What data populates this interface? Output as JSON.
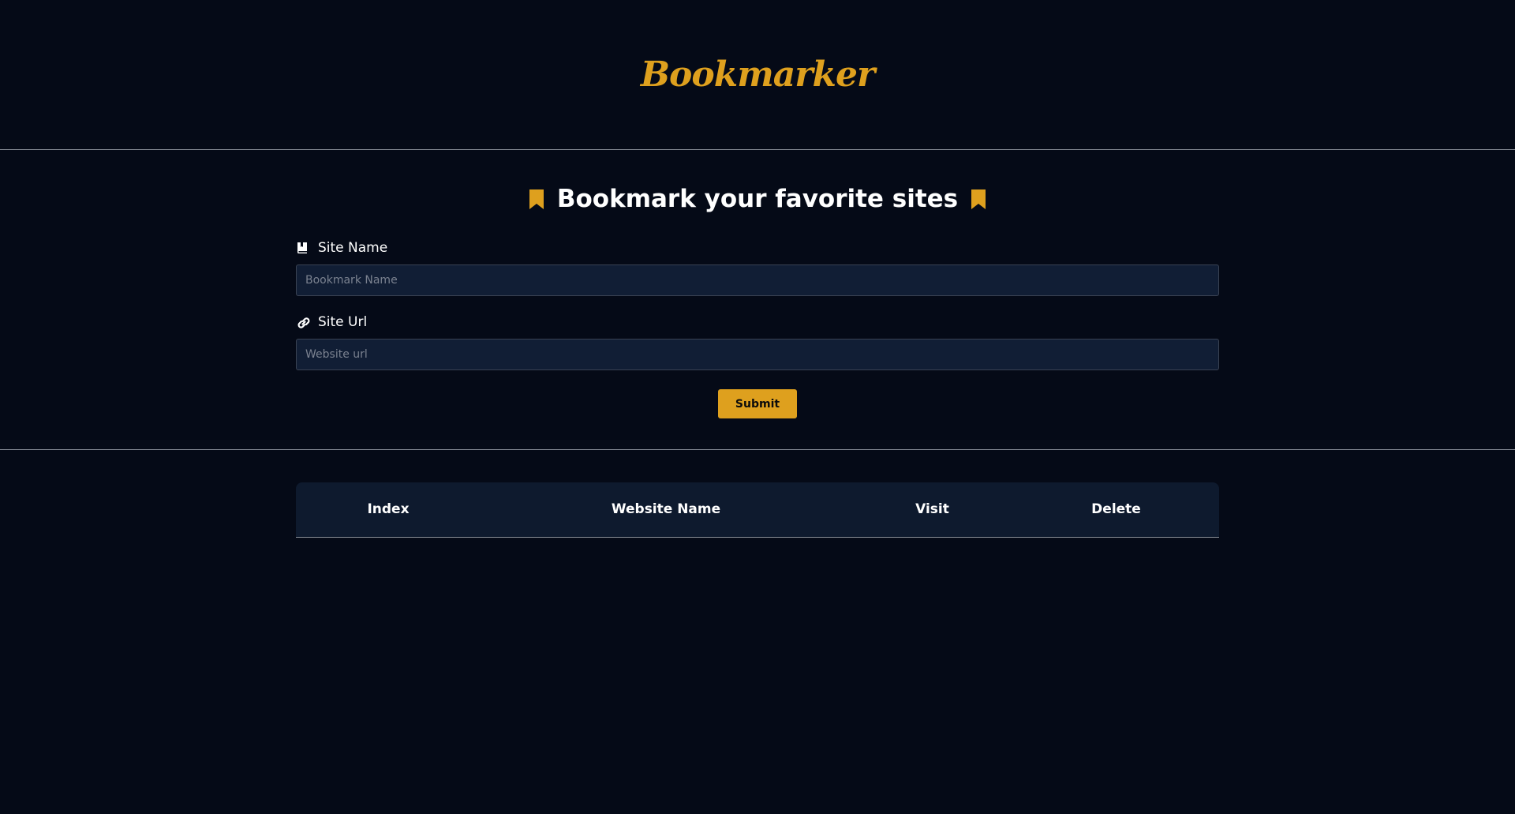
{
  "header": {
    "brand": "Bookmarker"
  },
  "form": {
    "headline": "Bookmark your favorite sites",
    "headline_icon": "bookmark-icon",
    "site_name": {
      "label": "Site Name",
      "icon": "book-icon",
      "placeholder": "Bookmark Name",
      "value": ""
    },
    "site_url": {
      "label": "Site Url",
      "icon": "link-icon",
      "placeholder": "Website url",
      "value": ""
    },
    "submit_label": "Submit"
  },
  "table": {
    "columns": [
      "Index",
      "Website Name",
      "Visit",
      "Delete"
    ],
    "rows": []
  },
  "colors": {
    "background": "#050a17",
    "accent": "#dea01e",
    "input_background": "#111e35",
    "table_header_background": "#0e1a2e"
  }
}
